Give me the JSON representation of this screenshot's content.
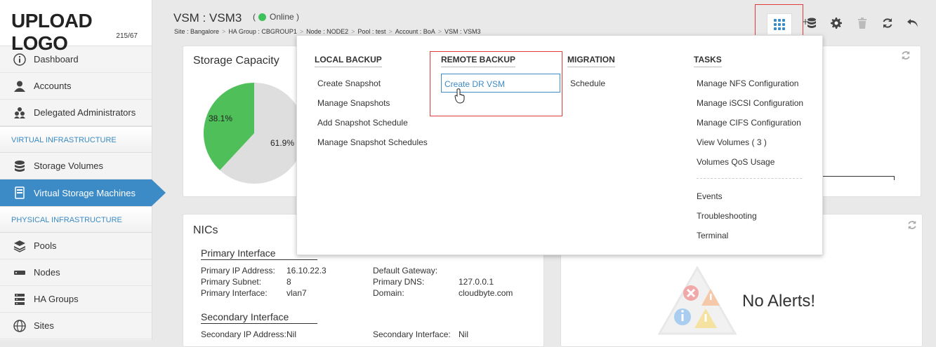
{
  "logo": {
    "text": "UPLOAD LOGO",
    "version": "215/67"
  },
  "sidebar": {
    "items_top": [
      {
        "label": "Dashboard",
        "icon": "info-icon"
      },
      {
        "label": "Accounts",
        "icon": "user-icon"
      },
      {
        "label": "Delegated Administrators",
        "icon": "users-icon"
      }
    ],
    "section_virtual": "VIRTUAL INFRASTRUCTURE",
    "items_virtual": [
      {
        "label": "Storage Volumes",
        "icon": "database-icon"
      },
      {
        "label": "Virtual Storage Machines",
        "icon": "server-icon"
      }
    ],
    "section_physical": "PHYSICAL INFRASTRUCTURE",
    "items_physical": [
      {
        "label": "Pools",
        "icon": "layers-icon"
      },
      {
        "label": "Nodes",
        "icon": "node-icon"
      },
      {
        "label": "HA Groups",
        "icon": "ha-groups-icon"
      },
      {
        "label": "Sites",
        "icon": "globe-icon"
      }
    ]
  },
  "header": {
    "title": "VSM : VSM3",
    "status": "Online",
    "breadcrumb": [
      "Site : Bangalore",
      "HA Group : CBGROUP1",
      "Node : NODE2",
      "Pool : test",
      "Account : BoA",
      "VSM : VSM3"
    ]
  },
  "storage": {
    "title": "Storage Capacity",
    "used_pct": "38.1%",
    "free_pct": "61.9%",
    "used_value": 38.1,
    "free_value": 61.9,
    "used_color": "#4fbf5a",
    "free_color": "#dedede"
  },
  "nics": {
    "title": "NICs",
    "primary_title": "Primary Interface",
    "primary": [
      {
        "k": "Primary IP Address:",
        "v": "16.10.22.3",
        "k2": "Default Gateway:",
        "v2": ""
      },
      {
        "k": "Primary Subnet:",
        "v": "8",
        "k2": "Primary DNS:",
        "v2": "127.0.0.1"
      },
      {
        "k": "Primary Interface:",
        "v": "vlan7",
        "k2": "Domain:",
        "v2": "cloudbyte.com"
      }
    ],
    "secondary_title": "Secondary Interface",
    "secondary": [
      {
        "k": "Secondary IP Address:",
        "v": "Nil",
        "k2": "Secondary Interface:",
        "v2": "Nil"
      }
    ]
  },
  "alerts": {
    "text": "No Alerts!"
  },
  "menu": {
    "local": {
      "title": "LOCAL BACKUP",
      "items": [
        "Create Snapshot",
        "Manage Snapshots",
        "Add Snapshot Schedule",
        "Manage Snapshot Schedules"
      ]
    },
    "remote": {
      "title": "REMOTE BACKUP",
      "items": [
        "Create DR VSM"
      ]
    },
    "migration": {
      "title": "MIGRATION",
      "items": [
        "Schedule"
      ]
    },
    "tasks": {
      "title": "TASKS",
      "items": [
        "Manage NFS Configuration",
        "Manage iSCSI Configuration",
        "Manage CIFS Configuration",
        "View Volumes ( 3 )",
        "Volumes QoS Usage"
      ],
      "items2": [
        "Events",
        "Troubleshooting",
        "Terminal"
      ]
    }
  },
  "colors": {
    "accent": "#3d8bc6",
    "highlight": "#e03c3c",
    "online": "#3ec15a"
  }
}
